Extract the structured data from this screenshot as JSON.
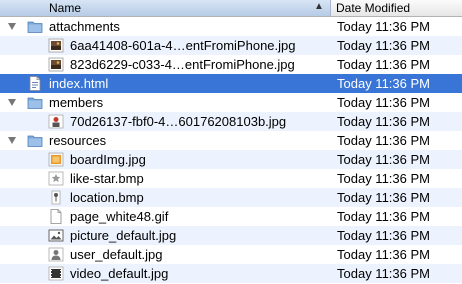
{
  "columns": {
    "name": "Name",
    "date_modified": "Date Modified",
    "sort_indicator": "▲"
  },
  "rows": [
    {
      "name": "attachments",
      "date": "Today 11:36 PM",
      "kind": "folder",
      "depth": 0,
      "expanded": true
    },
    {
      "name": "6aa41408-601a-4…entFromiPhone.jpg",
      "date": "Today 11:36 PM",
      "kind": "photo",
      "depth": 1
    },
    {
      "name": "823d6229-c033-4…entFromiPhone.jpg",
      "date": "Today 11:36 PM",
      "kind": "photo",
      "depth": 1
    },
    {
      "name": "index.html",
      "date": "Today 11:36 PM",
      "kind": "html",
      "depth": 0,
      "selected": true
    },
    {
      "name": "members",
      "date": "Today 11:36 PM",
      "kind": "folder",
      "depth": 0,
      "expanded": true
    },
    {
      "name": "70d26137-fbf0-4…60176208103b.jpg",
      "date": "Today 11:36 PM",
      "kind": "person",
      "depth": 1
    },
    {
      "name": "resources",
      "date": "Today 11:36 PM",
      "kind": "folder",
      "depth": 0,
      "expanded": true
    },
    {
      "name": "boardImg.jpg",
      "date": "Today 11:36 PM",
      "kind": "board",
      "depth": 1
    },
    {
      "name": "like-star.bmp",
      "date": "Today 11:36 PM",
      "kind": "star",
      "depth": 1
    },
    {
      "name": "location.bmp",
      "date": "Today 11:36 PM",
      "kind": "pin",
      "depth": 1
    },
    {
      "name": "page_white48.gif",
      "date": "Today 11:36 PM",
      "kind": "page",
      "depth": 1
    },
    {
      "name": "picture_default.jpg",
      "date": "Today 11:36 PM",
      "kind": "picture",
      "depth": 1
    },
    {
      "name": "user_default.jpg",
      "date": "Today 11:36 PM",
      "kind": "user",
      "depth": 1
    },
    {
      "name": "video_default.jpg",
      "date": "Today 11:36 PM",
      "kind": "video",
      "depth": 1
    }
  ],
  "colors": {
    "selection": "#3875d7",
    "alternate_row": "#edf3fe",
    "header_sorted": "#c6d8ef",
    "folder": "#7ba8db"
  }
}
